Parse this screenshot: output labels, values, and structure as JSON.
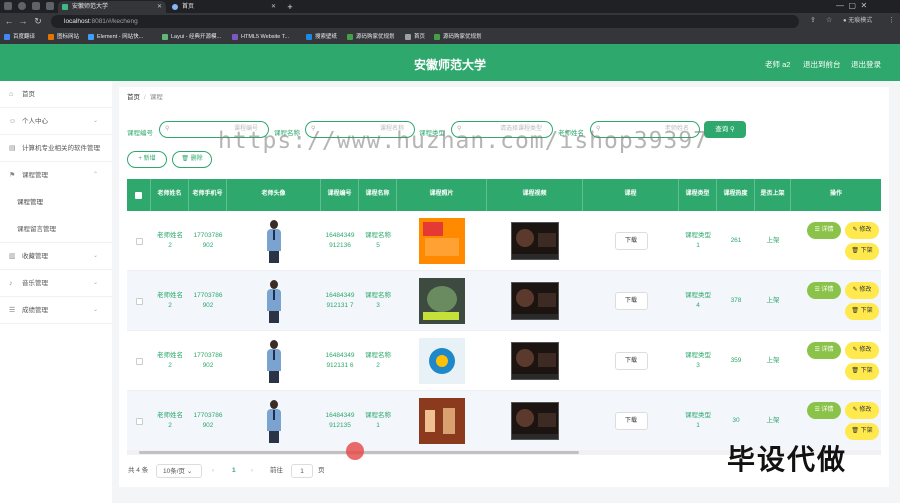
{
  "browser": {
    "tabs": [
      {
        "label": "安徽师范大学",
        "active": true
      },
      {
        "label": "首页",
        "active": false
      }
    ],
    "url_host": "localhost",
    "url_rest": ":8081/#/kecheng",
    "profile": "无痕模式",
    "bookmarks": [
      "百度翻译",
      "图标网站",
      "Element - 网站快...",
      "Layui - 经典开源模...",
      "HTML5 Website T...",
      "搜索壁纸",
      "源码购家优规划",
      "首页",
      "源码购家优规划"
    ]
  },
  "header": {
    "title": "安徽师范大学",
    "links": [
      "老师 a2",
      "退出到前台",
      "退出登录"
    ]
  },
  "sidebar": {
    "items": [
      {
        "label": "首页",
        "icon": "home-icon"
      },
      {
        "label": "个人中心",
        "icon": "user-icon"
      },
      {
        "label": "计算机专业相关的软件管理",
        "icon": "document-icon"
      },
      {
        "label": "课程管理",
        "icon": "flag-icon"
      },
      {
        "label": "课程管理",
        "sub": true
      },
      {
        "label": "课程留言管理",
        "sub": true
      },
      {
        "label": "收藏管理",
        "icon": "chart-icon"
      },
      {
        "label": "音乐管理",
        "icon": "music-icon"
      },
      {
        "label": "成绩管理",
        "icon": "list-icon"
      }
    ]
  },
  "breadcrumb": {
    "home": "首页",
    "current": "课程"
  },
  "search": {
    "fields": [
      {
        "label": "课程编号",
        "placeholder": "课程编号"
      },
      {
        "label": "课程名称",
        "placeholder": "课程名称"
      },
      {
        "label": "课程类型",
        "placeholder": "请选择课程类型"
      },
      {
        "label": "老师姓名",
        "placeholder": "老师姓名"
      }
    ],
    "button": "查询"
  },
  "actions": {
    "add": "新增",
    "delete": "删除"
  },
  "table": {
    "columns": [
      "老师姓名",
      "老师手机号",
      "老师头像",
      "课程编号",
      "课程名称",
      "课程照片",
      "课程视频",
      "课程",
      "课程类型",
      "课程热度",
      "是否上架",
      "操作"
    ],
    "rows": [
      {
        "teacher": "老师姓名2",
        "phone": "17703786902",
        "code": "16484349912136",
        "name": "课程名称5",
        "file": "下载",
        "type": "课程类型1",
        "heat": "261",
        "shelf": "上架"
      },
      {
        "teacher": "老师姓名2",
        "phone": "17703786902",
        "code": "16484349912131 7",
        "name": "课程名称3",
        "file": "下载",
        "type": "课程类型4",
        "heat": "378",
        "shelf": "上架"
      },
      {
        "teacher": "老师姓名2",
        "phone": "17703786902",
        "code": "16484349912131 6",
        "name": "课程名称2",
        "file": "下载",
        "type": "课程类型3",
        "heat": "359",
        "shelf": "上架"
      },
      {
        "teacher": "老师姓名2",
        "phone": "17703786902",
        "code": "16484349912135",
        "name": "课程名称1",
        "file": "下载",
        "type": "课程类型1",
        "heat": "30",
        "shelf": "上架"
      }
    ],
    "row_actions": {
      "detail": "详情",
      "edit": "修改",
      "remove": "下架"
    }
  },
  "pagination": {
    "total": "共 4 条",
    "page_size": "10条/页",
    "page": "1",
    "goto_prefix": "前往",
    "goto_value": "1",
    "goto_suffix": "页"
  },
  "watermark": "https://www.huzhan.com/ishop39397",
  "overlay_text": "毕设代做",
  "colors": {
    "primary": "#2ea86c",
    "detail": "#8bc34a",
    "edit": "#ffe94d"
  }
}
